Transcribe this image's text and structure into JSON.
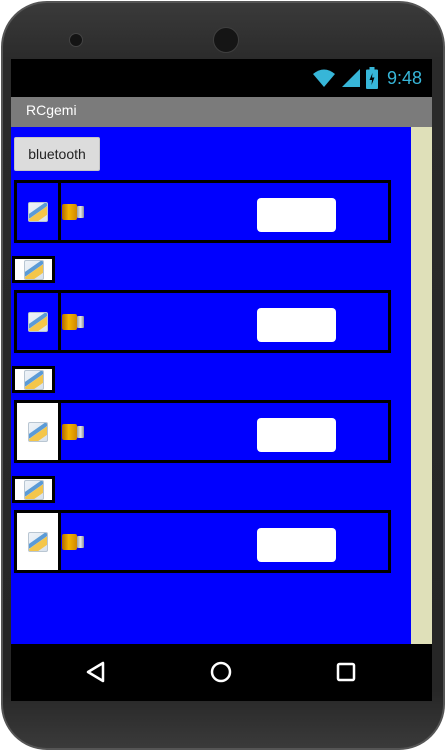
{
  "status_bar": {
    "time": "9:48",
    "icons": [
      "wifi-icon",
      "signal-icon",
      "battery-icon"
    ],
    "accent_color": "#37b6d8"
  },
  "app": {
    "title": "RCgemi",
    "background_color": "#0000ff"
  },
  "controls": {
    "bluetooth_button_label": "bluetooth"
  },
  "rows": [
    {
      "left_icon": "image-icon",
      "motor_icon": "motor-icon",
      "left_panel": "blue",
      "text_value": ""
    },
    {
      "left_icon": "image-icon",
      "motor_icon": "motor-icon",
      "left_panel": "blue",
      "text_value": ""
    },
    {
      "left_icon": "image-icon",
      "motor_icon": "motor-icon",
      "left_panel": "white",
      "text_value": ""
    },
    {
      "left_icon": "image-icon",
      "motor_icon": "motor-icon",
      "left_panel": "white",
      "text_value": ""
    }
  ],
  "nav_bar": {
    "icons": [
      "back-icon",
      "home-icon",
      "recents-icon"
    ]
  }
}
